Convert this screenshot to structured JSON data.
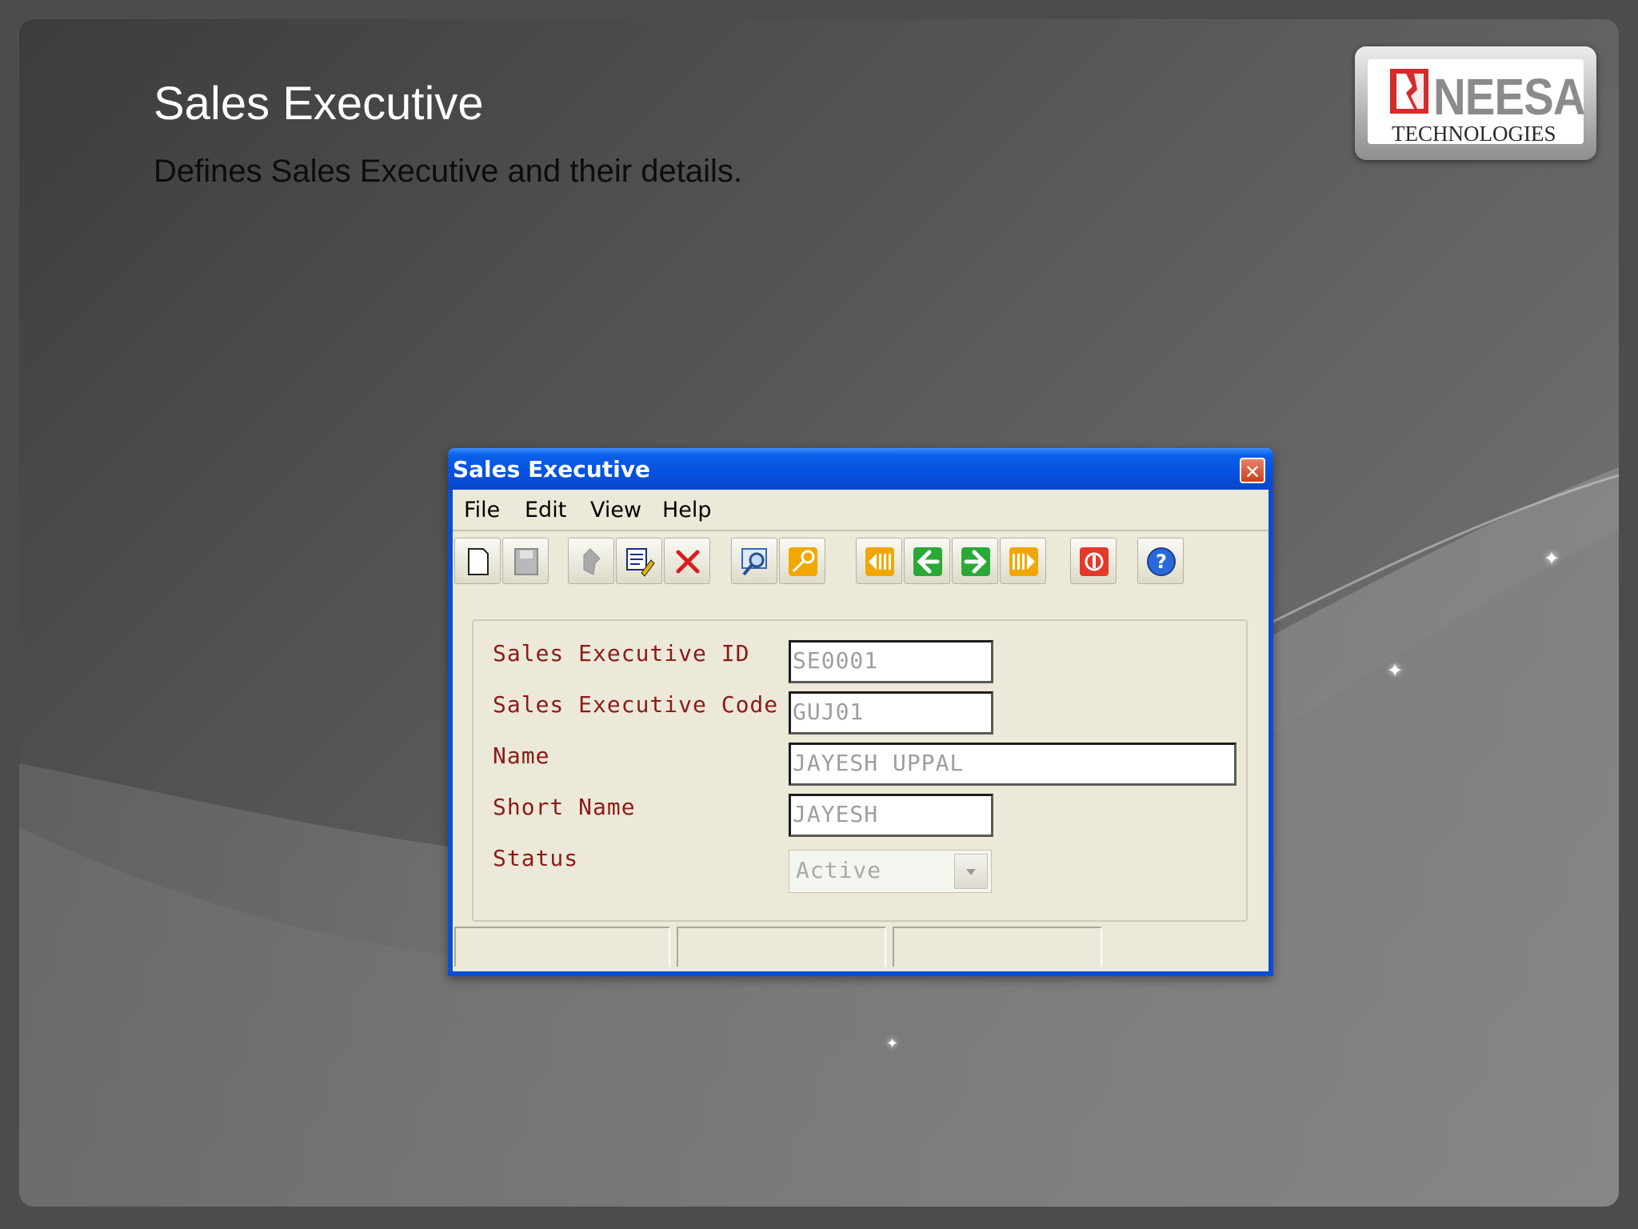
{
  "slide": {
    "title": "Sales Executive",
    "subtitle": "Defines Sales Executive and their details."
  },
  "logo": {
    "brand": "NEESA",
    "tagline": "TECHNOLOGIES",
    "mark_color": "#d42b2b"
  },
  "window": {
    "title": "Sales Executive",
    "close_glyph": "✕",
    "menu": [
      "File",
      "Edit",
      "View",
      "Help"
    ],
    "toolbar": [
      {
        "icon": "new-document-icon"
      },
      {
        "icon": "save-icon"
      },
      {
        "icon": "undo-icon"
      },
      {
        "icon": "edit-icon"
      },
      {
        "icon": "delete-icon"
      },
      {
        "icon": "find-icon"
      },
      {
        "icon": "key-icon"
      },
      {
        "icon": "first-record-icon"
      },
      {
        "icon": "previous-record-icon"
      },
      {
        "icon": "next-record-icon"
      },
      {
        "icon": "last-record-icon"
      },
      {
        "icon": "exit-icon"
      },
      {
        "icon": "help-icon"
      }
    ],
    "form": {
      "sales_executive_id_label": "Sales Executive ID",
      "sales_executive_id_value": "SE0001",
      "sales_executive_code_label": "Sales Executive Code",
      "sales_executive_code_value": "GUJ01",
      "name_label": "Name",
      "name_value": "JAYESH UPPAL",
      "short_name_label": "Short Name",
      "short_name_value": "JAYESH",
      "status_label": "Status",
      "status_value": "Active"
    }
  },
  "colors": {
    "titlebar": "#0651e0",
    "label_text": "#8b1a1a",
    "window_bg": "#ece9d8"
  }
}
